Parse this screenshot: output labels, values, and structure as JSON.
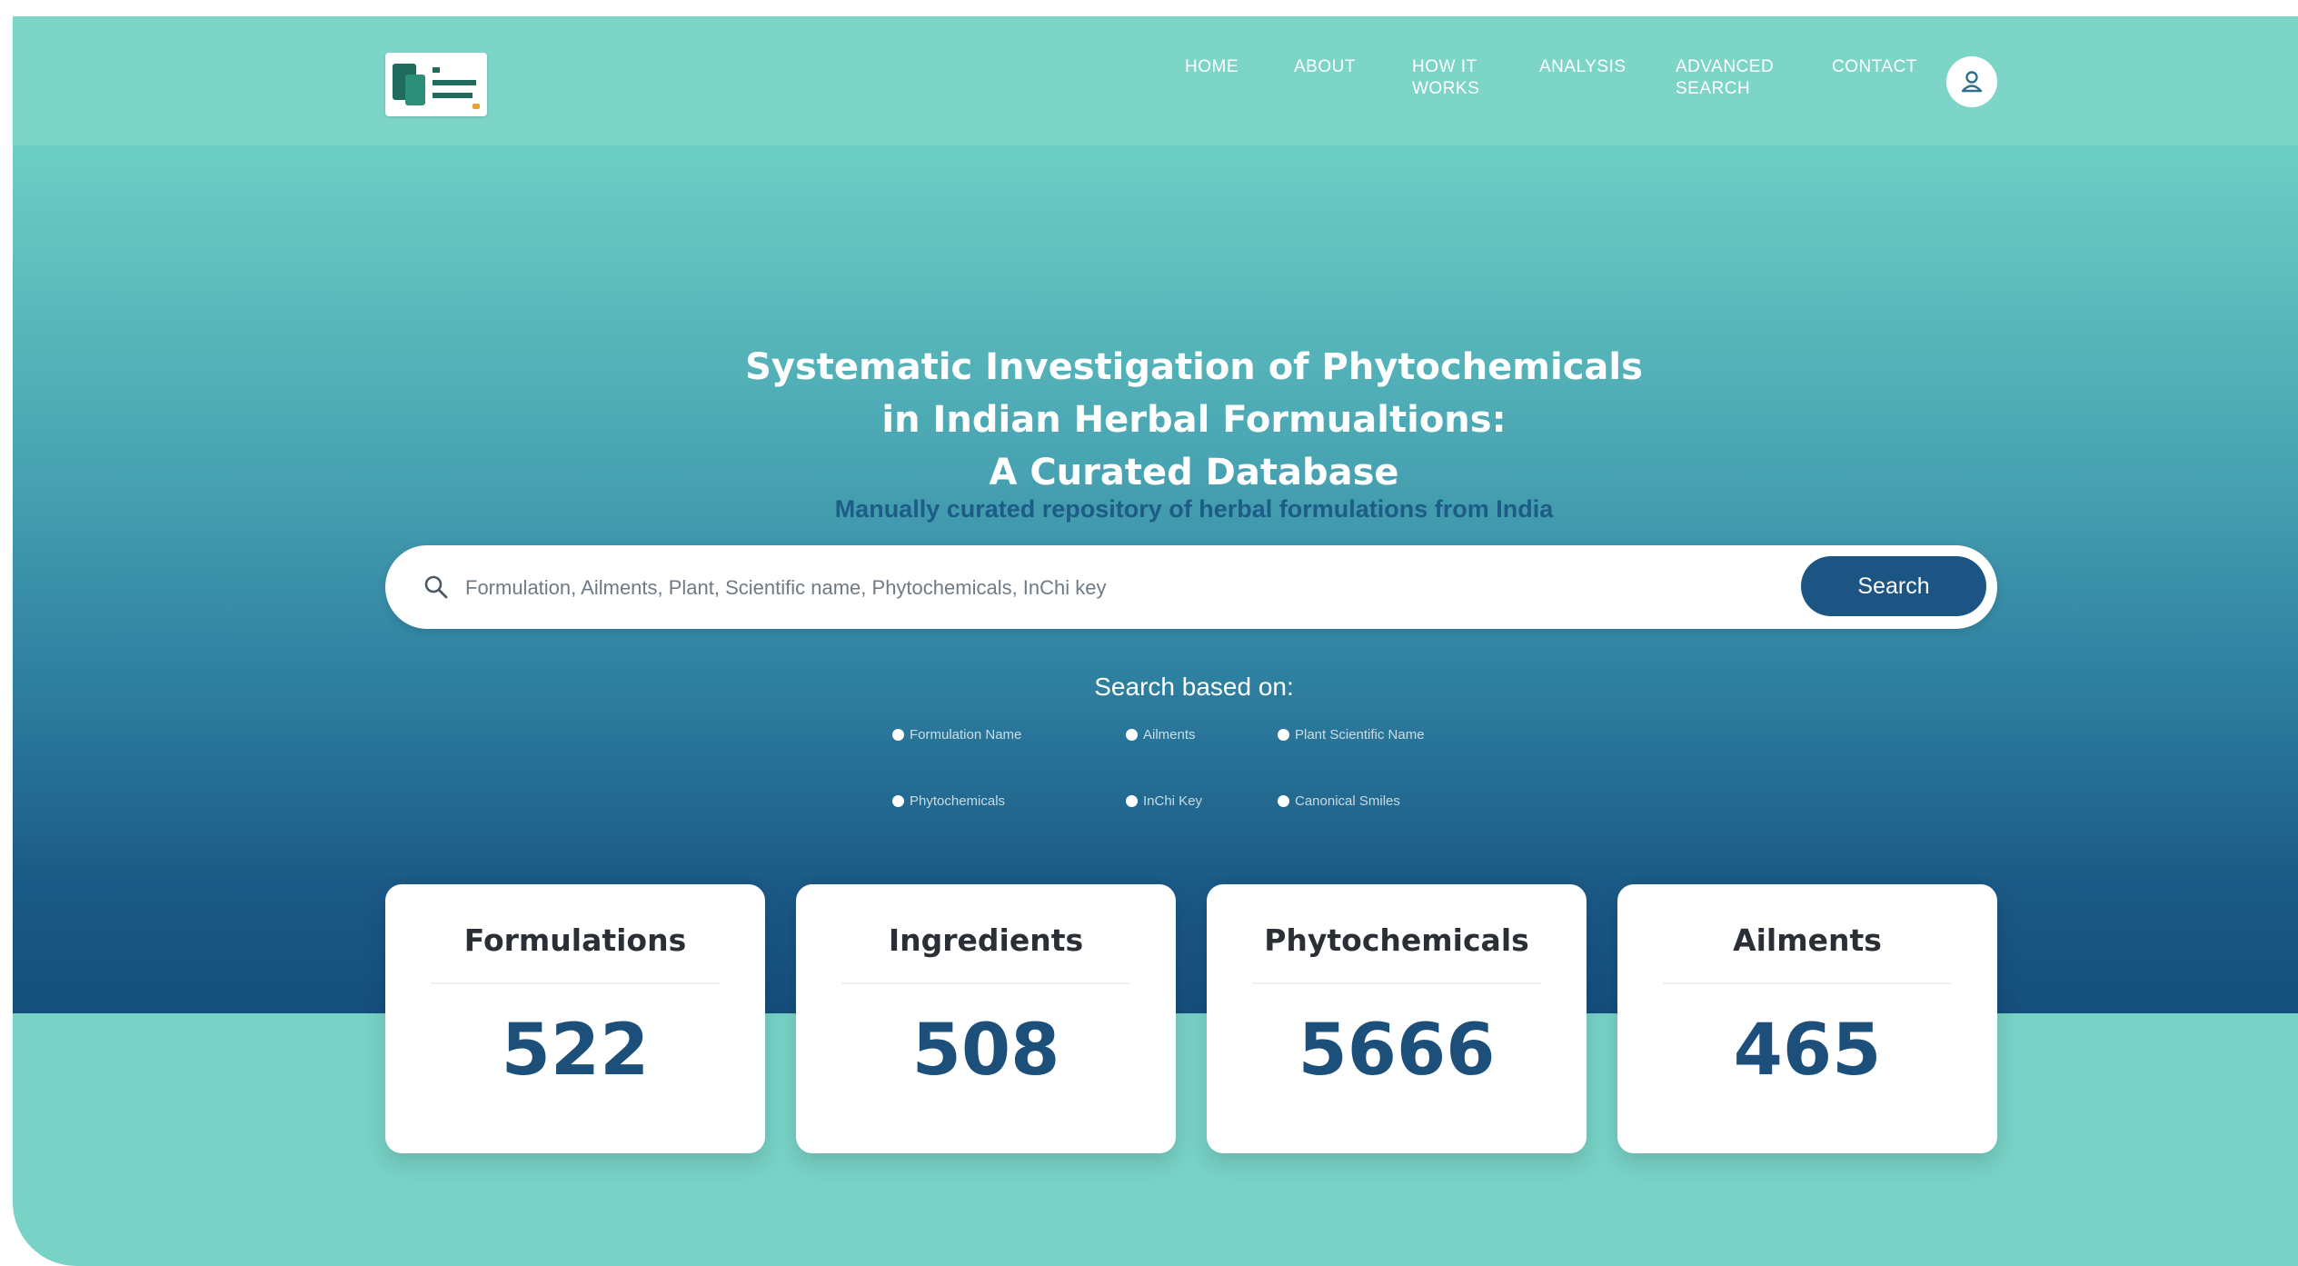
{
  "colors": {
    "nav_background": "#7dd5c8",
    "hero_gradient_top": "#6ccfc4",
    "hero_gradient_bottom": "#154f7c",
    "accent_blue": "#1c5484",
    "stat_number": "#1d4f7b",
    "page_background": "#78d2c6"
  },
  "nav": {
    "logo_icon": "database-logo",
    "items": [
      {
        "label": "HOME"
      },
      {
        "label": "ABOUT"
      },
      {
        "label": "HOW IT\nWORKS"
      },
      {
        "label": "ANALYSIS"
      },
      {
        "label": "ADVANCED\nSEARCH"
      },
      {
        "label": "CONTACT"
      }
    ],
    "user_icon": "user-icon"
  },
  "hero": {
    "title_lines": [
      "Systematic Investigation of Phytochemicals",
      "in Indian Herbal Formualtions:",
      "A Curated Database"
    ],
    "subtitle": "Manually curated repository of herbal formulations from India"
  },
  "search": {
    "icon": "search-icon",
    "placeholder": "Formulation, Ailments, Plant, Scientific name, Phytochemicals, InChi key",
    "button_label": "Search",
    "based_on_label": "Search based on:",
    "options": [
      {
        "label": "Formulation Name"
      },
      {
        "label": "Ailments"
      },
      {
        "label": "Plant Scientific Name"
      },
      {
        "label": "Phytochemicals"
      },
      {
        "label": "InChi Key"
      },
      {
        "label": "Canonical Smiles"
      }
    ]
  },
  "stats": [
    {
      "label": "Formulations",
      "value": "522"
    },
    {
      "label": "Ingredients",
      "value": "508"
    },
    {
      "label": "Phytochemicals",
      "value": "5666"
    },
    {
      "label": "Ailments",
      "value": "465"
    }
  ]
}
